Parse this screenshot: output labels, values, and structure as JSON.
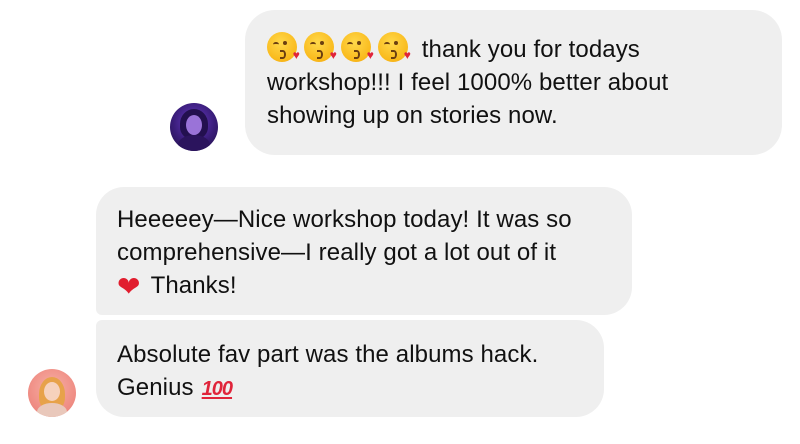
{
  "messages": [
    {
      "sender": "other",
      "emoji_prefix": [
        "face-blowing-a-kiss-icon",
        "face-blowing-a-kiss-icon",
        "face-blowing-a-kiss-icon",
        "face-blowing-a-kiss-icon"
      ],
      "lines": [
        "thank you for todays",
        "workshop!!! I feel 1000% better about",
        "showing up on stories now."
      ]
    },
    {
      "sender": "self",
      "lines": [
        "Heeeeey—Nice workshop today! It was so",
        "comprehensive—I really got a lot out of it",
        "Thanks!"
      ],
      "inline_emoji": "red-heart-icon"
    },
    {
      "sender": "self",
      "lines": [
        "Absolute fav part was the albums hack.",
        "Genius"
      ],
      "inline_emoji": "hundred-points-icon",
      "hundred_text": "100"
    }
  ],
  "emoji_glyphs": {
    "heart": "❤",
    "small_heart": "♥"
  },
  "colors": {
    "bubble": "#efefef",
    "text": "#111111",
    "heart": "#e11d2e"
  }
}
